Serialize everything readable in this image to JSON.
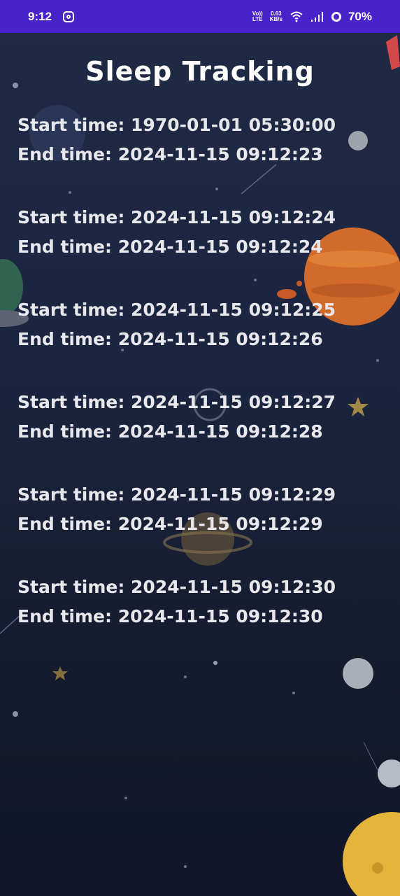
{
  "status_bar": {
    "time": "9:12",
    "volte_top": "Vo))",
    "volte_bottom": "LTE",
    "speed_top": "0.63",
    "speed_bottom": "KB/s",
    "battery": "70%",
    "icons": [
      "instagram-icon",
      "wifi-icon",
      "signal-icon",
      "battery-ring-icon"
    ]
  },
  "header": {
    "title": "Sleep Tracking"
  },
  "sessions": [
    {
      "start": "Start time: 1970-01-01 05:30:00",
      "end": "End time: 2024-11-15 09:12:23"
    },
    {
      "start": "Start time: 2024-11-15 09:12:24",
      "end": "End time: 2024-11-15 09:12:24"
    },
    {
      "start": "Start time: 2024-11-15 09:12:25",
      "end": "End time: 2024-11-15 09:12:26"
    },
    {
      "start": "Start time: 2024-11-15 09:12:27",
      "end": "End time: 2024-11-15 09:12:28"
    },
    {
      "start": "Start time: 2024-11-15 09:12:29",
      "end": "End time: 2024-11-15 09:12:29"
    },
    {
      "start": "Start time: 2024-11-15 09:12:30",
      "end": "End time: 2024-11-15 09:12:30"
    }
  ],
  "colors": {
    "status_bar": "#4a22c9",
    "background": "#1c2540",
    "text": "#e8e8ec"
  }
}
